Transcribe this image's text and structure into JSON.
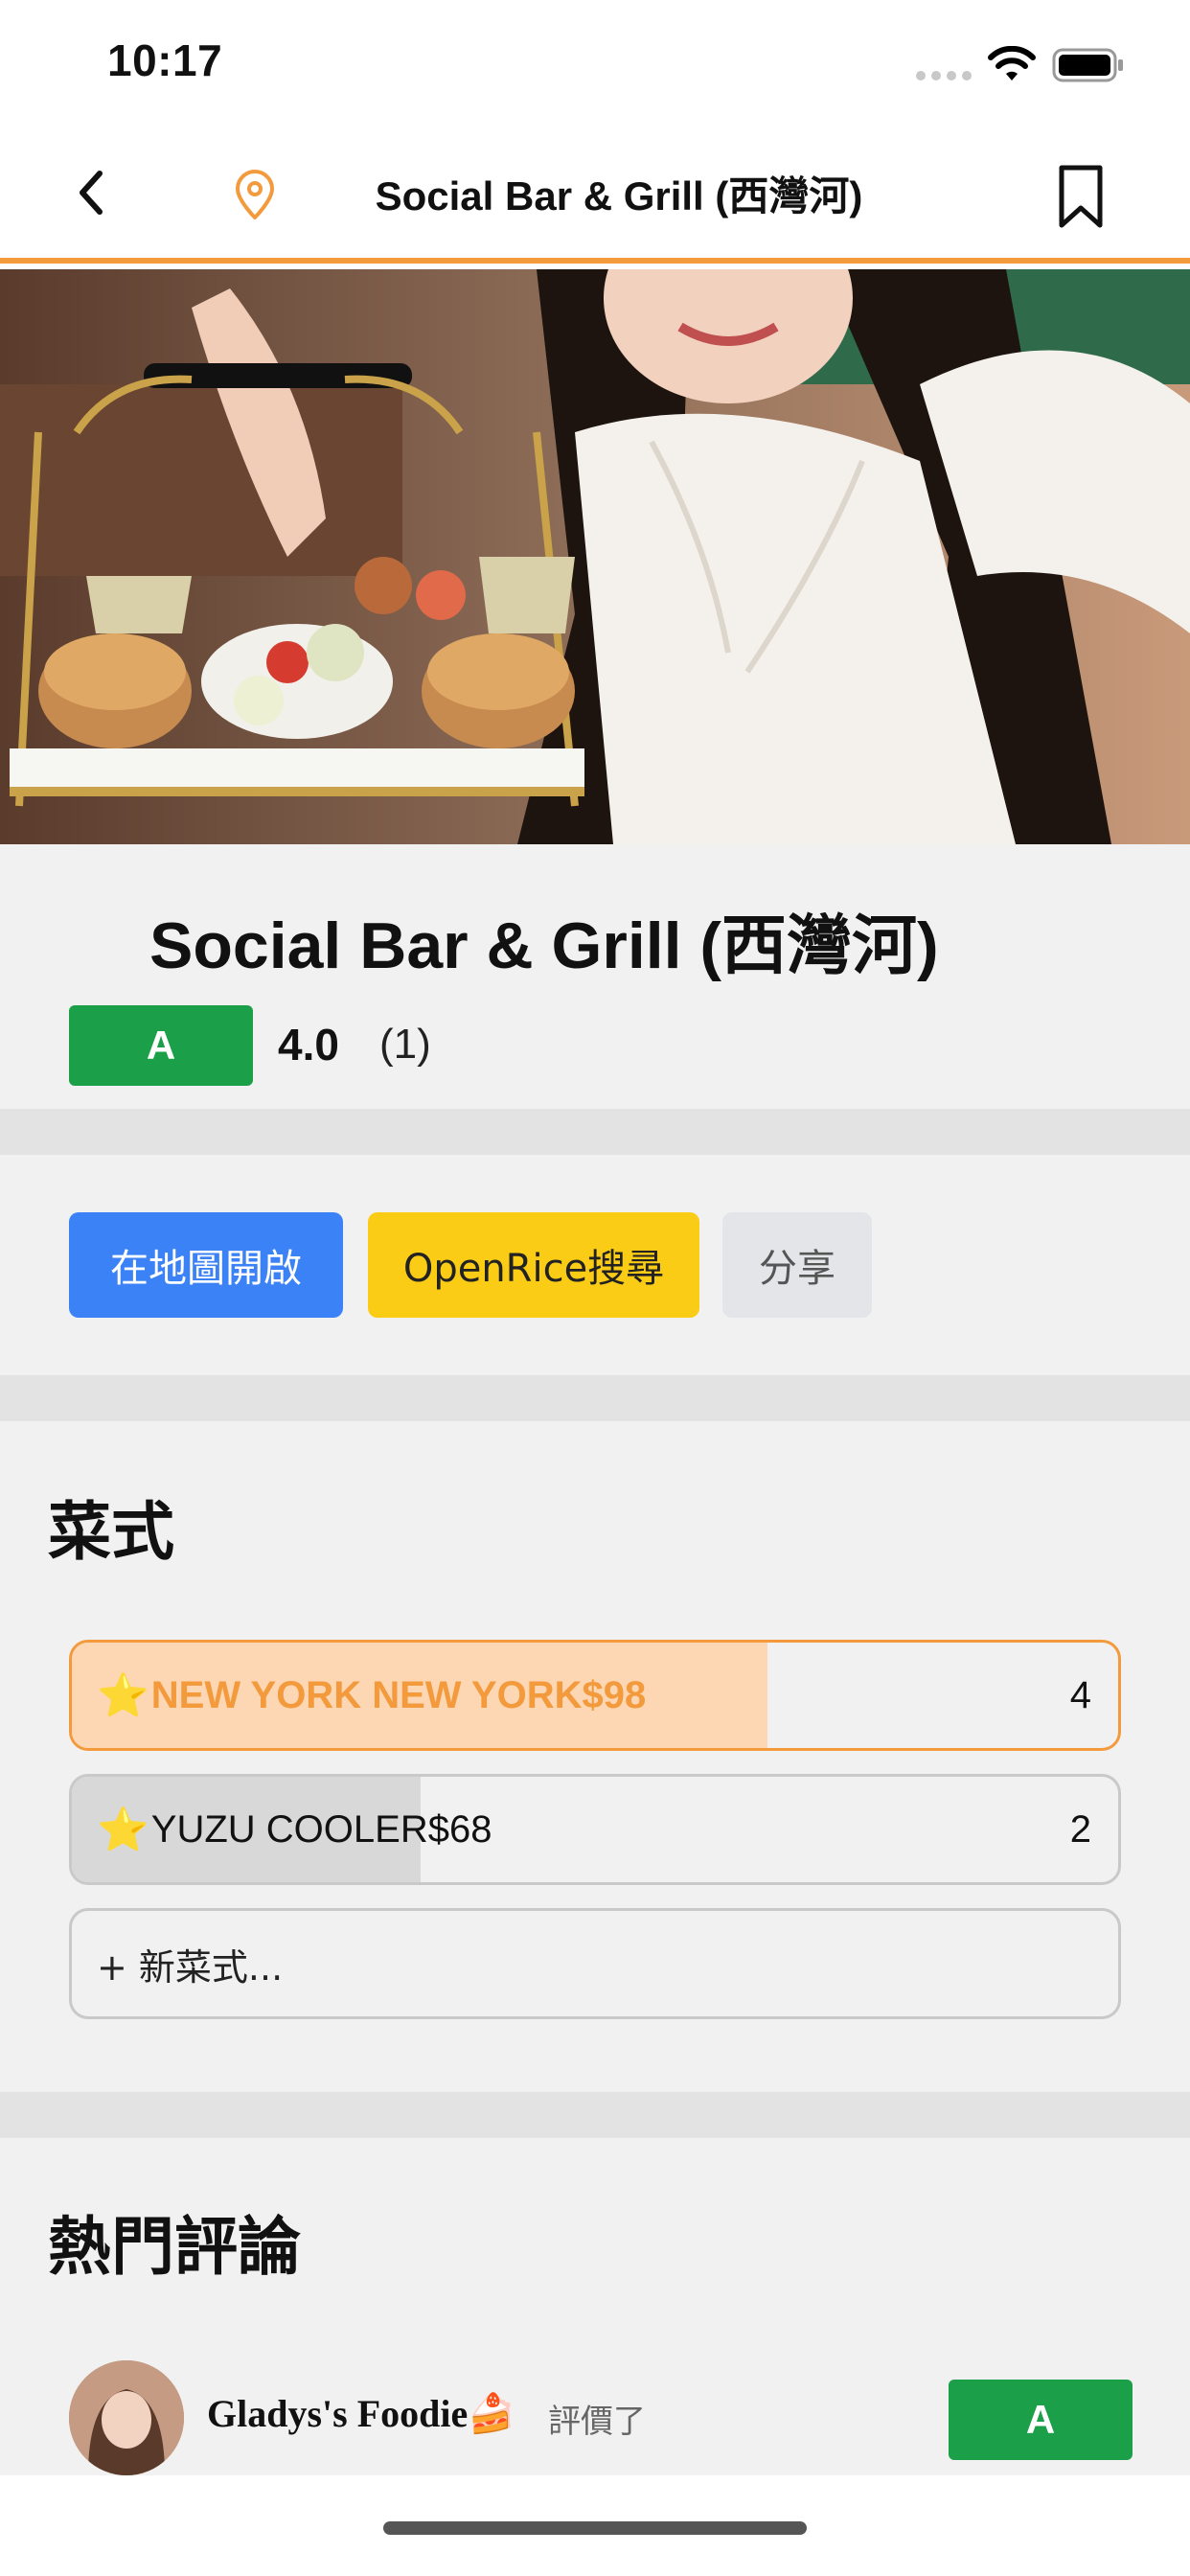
{
  "status": {
    "time": "10:17"
  },
  "nav": {
    "title": "Social Bar & Grill (西灣河)",
    "accent": "#f39a3d"
  },
  "place": {
    "name": "Social Bar & Grill (西灣河)",
    "grade": "A",
    "grade_color": "#1b9f48",
    "score": "4.0",
    "count": "(1)"
  },
  "actions": {
    "map_label": "在地圖開啟",
    "openrice_label": "OpenRice搜尋",
    "share_label": "分享"
  },
  "dishes": {
    "heading": "菜式",
    "items": [
      {
        "name": "NEW YORK NEW YORK$98",
        "count": "4",
        "share": 1.0,
        "highlight": true
      },
      {
        "name": "YUZU COOLER$68",
        "count": "2",
        "share": 0.5,
        "highlight": false
      }
    ],
    "new_label": "+ 新菜式..."
  },
  "reviews": {
    "heading": "熱門評論",
    "items": [
      {
        "author": "Gladys's Foodie",
        "action": "評價了",
        "grade": "A"
      }
    ]
  }
}
